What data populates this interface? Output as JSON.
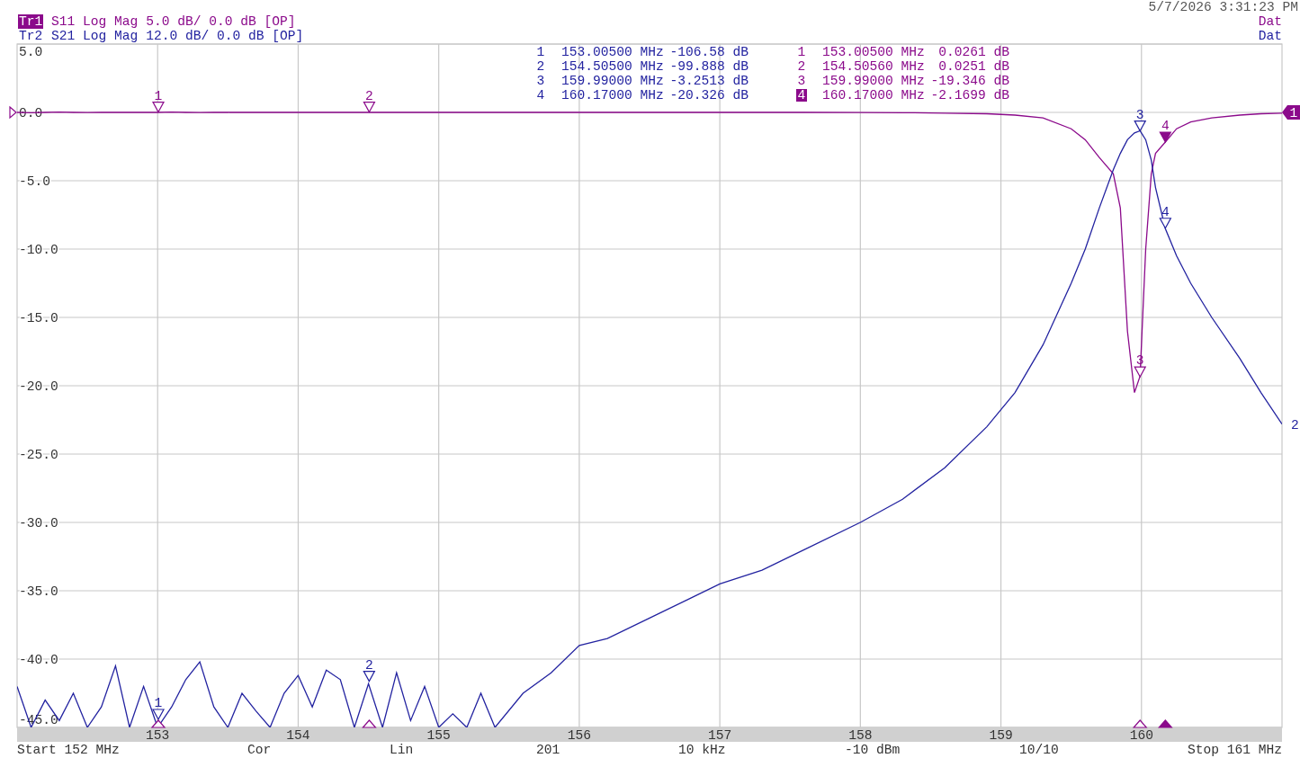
{
  "timestamp": "5/7/2026 3:31:23 PM",
  "traces": [
    {
      "label": "Tr1",
      "format": "Log Mag",
      "scale": "5.0 dB/",
      "ref": "0.0 dB",
      "tag": "[OP]",
      "status": "Dat",
      "active": true,
      "color": "#8b0a8b",
      "ref_badge": "1",
      "markers": [
        {
          "number": "1",
          "flag": "1",
          "stimulus": "153.00500 MHz",
          "response": "0.0261 dB",
          "active": false
        },
        {
          "number": "2",
          "flag": "2",
          "stimulus": "154.50560 MHz",
          "response": "0.0251 dB",
          "active": false
        },
        {
          "number": "3",
          "flag": "3",
          "stimulus": "159.99000 MHz",
          "response": "-19.346 dB",
          "active": false
        },
        {
          "number": "4",
          "flag": "4",
          "stimulus": "160.17000 MHz",
          "response": "-2.1699 dB",
          "active": true
        }
      ]
    },
    {
      "label": "Tr2",
      "format": "Log Mag",
      "scale": "12.0 dB/",
      "ref": "0.0 dB",
      "tag": "[OP]",
      "status": "Dat",
      "active": false,
      "color": "#2323a0",
      "end_label": "2",
      "markers": [
        {
          "number": "1",
          "flag": "1",
          "stimulus": "153.00500 MHz",
          "response": "-106.58 dB",
          "active": false
        },
        {
          "number": "2",
          "flag": "2",
          "stimulus": "154.50500 MHz",
          "response": "-99.888 dB",
          "active": false
        },
        {
          "number": "3",
          "flag": "3",
          "stimulus": "159.99000 MHz",
          "response": "-3.2513 dB",
          "active": false
        },
        {
          "number": "4",
          "flag": "4",
          "stimulus": "160.17000 MHz",
          "response": "-20.326 dB",
          "active": false
        }
      ]
    }
  ],
  "chart_data": {
    "type": "line",
    "grid": true,
    "xlim": [
      152,
      161
    ],
    "ylim": [
      -45,
      5
    ],
    "xticks": [
      {
        "value": 153,
        "label": "153"
      },
      {
        "value": 154,
        "label": "154"
      },
      {
        "value": 155,
        "label": "155"
      },
      {
        "value": 156,
        "label": "156"
      },
      {
        "value": 157,
        "label": "157"
      },
      {
        "value": 158,
        "label": "158"
      },
      {
        "value": 159,
        "label": "159"
      },
      {
        "value": 160,
        "label": "160"
      }
    ],
    "yticks": [
      {
        "value": 5,
        "label": "5.0"
      },
      {
        "value": 0,
        "label": "0.0"
      },
      {
        "value": -5,
        "label": "-5.0"
      },
      {
        "value": -10,
        "label": "-10.0"
      },
      {
        "value": -15,
        "label": "-15.0"
      },
      {
        "value": -20,
        "label": "-20.0"
      },
      {
        "value": -25,
        "label": "-25.0"
      },
      {
        "value": -30,
        "label": "-30.0"
      },
      {
        "value": -35,
        "label": "-35.0"
      },
      {
        "value": -40,
        "label": "-40.0"
      },
      {
        "value": -45,
        "label": "-45.0"
      }
    ],
    "x": [
      152.0,
      152.1,
      152.2,
      152.3,
      152.4,
      152.5,
      152.6,
      152.7,
      152.8,
      152.9,
      153.0,
      153.1,
      153.2,
      153.3,
      153.4,
      153.5,
      153.6,
      153.7,
      153.8,
      153.9,
      154.0,
      154.1,
      154.2,
      154.3,
      154.4,
      154.5,
      154.6,
      154.7,
      154.8,
      154.9,
      155.0,
      155.1,
      155.2,
      155.3,
      155.4,
      155.6,
      155.8,
      156.0,
      156.2,
      156.5,
      156.8,
      157.0,
      157.3,
      157.6,
      158.0,
      158.3,
      158.6,
      158.9,
      159.1,
      159.3,
      159.5,
      159.6,
      159.7,
      159.8,
      159.85,
      159.9,
      159.95,
      159.99,
      160.03,
      160.07,
      160.1,
      160.17,
      160.25,
      160.35,
      160.5,
      160.7,
      160.85,
      161.0
    ],
    "series": [
      {
        "name": "S11",
        "color": "#8b0a8b",
        "values": [
          0,
          -0.02,
          0,
          0.02,
          0,
          -0.01,
          0,
          0.01,
          0,
          0,
          0,
          0.02,
          0,
          -0.01,
          0,
          0,
          0.01,
          0,
          0,
          0,
          0,
          0,
          0,
          0,
          0,
          0,
          0,
          0,
          0,
          0,
          0,
          0,
          0,
          0,
          0,
          0,
          0,
          0,
          0,
          0,
          0,
          0,
          0,
          0,
          -0.01,
          -0.02,
          -0.05,
          -0.1,
          -0.2,
          -0.4,
          -1.2,
          -2,
          -3.3,
          -4.5,
          -7,
          -16,
          -20.5,
          -19.3,
          -10,
          -4.5,
          -3,
          -2.17,
          -1.2,
          -0.7,
          -0.4,
          -0.2,
          -0.1,
          -0.05
        ]
      },
      {
        "name": "S21",
        "color": "#2323a0",
        "values": [
          -42,
          -45,
          -43,
          -44.5,
          -42.5,
          -45,
          -43.5,
          -40.5,
          -45,
          -42,
          -45,
          -43.5,
          -41.5,
          -40.2,
          -43.5,
          -45,
          -42.5,
          -43.8,
          -45,
          -42.5,
          -41.2,
          -43.5,
          -40.8,
          -41.5,
          -45,
          -41.8,
          -45,
          -41,
          -44.5,
          -42,
          -45,
          -44,
          -45,
          -42.5,
          -45,
          -42.5,
          -41,
          -39,
          -38.5,
          -37,
          -35.5,
          -34.5,
          -33.5,
          -32,
          -30,
          -28.3,
          -26,
          -23,
          -20.5,
          -17,
          -12.5,
          -10,
          -7,
          -4.2,
          -3,
          -2,
          -1.5,
          -1.35,
          -2,
          -3.5,
          -5.5,
          -8.5,
          -10.5,
          -12.5,
          -15,
          -18,
          -20.5,
          -22.8
        ]
      }
    ]
  },
  "footer": [
    "Start 152 MHz",
    "Cor",
    "Lin",
    "201",
    "10 kHz",
    "-10 dBm",
    "10/10",
    "Stop 161 MHz"
  ]
}
